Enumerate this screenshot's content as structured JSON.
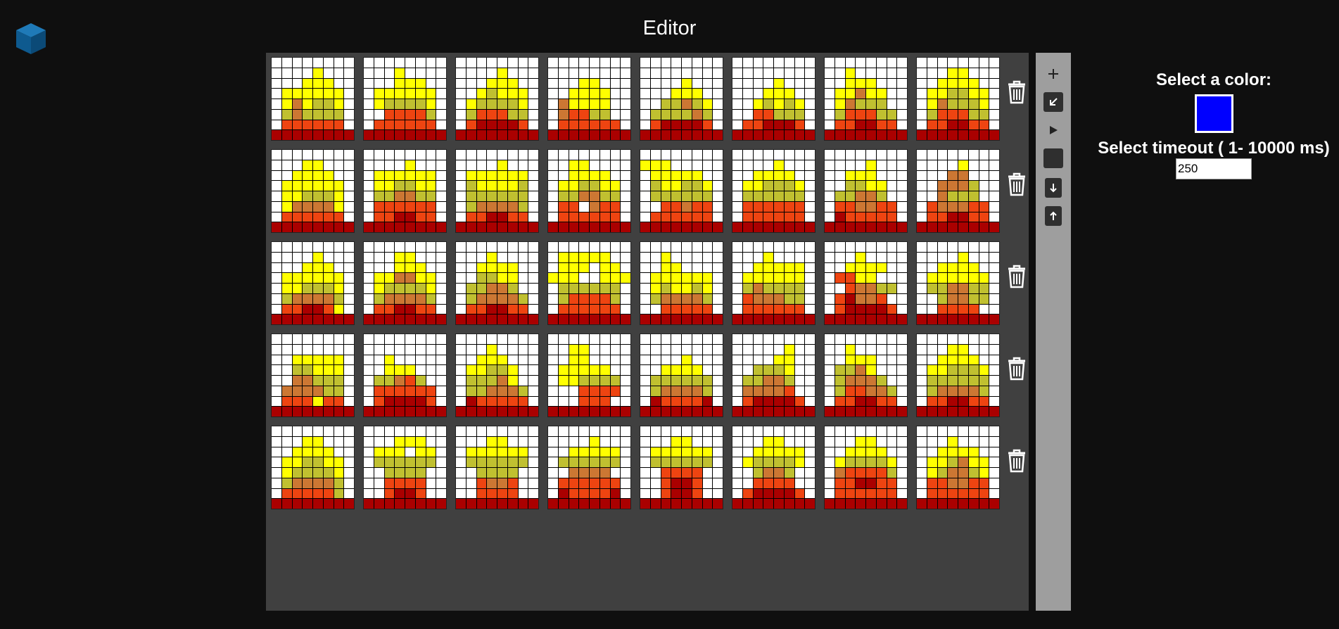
{
  "header": {
    "title": "Editor"
  },
  "app": {
    "logo_icon": "cube-icon"
  },
  "sidebar": {
    "color_label": "Select a color:",
    "selected_color": "#0000ff",
    "timeout_label": "Select timeout ( 1- 10000 ms)",
    "timeout_value": "250"
  },
  "toolbar": {
    "buttons": [
      {
        "name": "add-frame-button",
        "icon": "plus-icon"
      },
      {
        "name": "collapse-button",
        "icon": "arrow-down-left-icon"
      },
      {
        "name": "play-button",
        "icon": "play-icon"
      },
      {
        "name": "stop-button",
        "icon": "stop-icon"
      },
      {
        "name": "download-button",
        "icon": "arrow-down-icon"
      },
      {
        "name": "upload-button",
        "icon": "arrow-up-icon"
      }
    ]
  },
  "palette": {
    "W": "#ffffff",
    "Y": "#ffff00",
    "O": "#c0c030",
    "B": "#cc7733",
    "R": "#ee4411",
    "D": "#aa0000"
  },
  "frames": [
    [
      "WWWWWWWW",
      "WWWWYWWW",
      "WWWYYYWW",
      "WYYYYYYW",
      "WYBYOOYW",
      "WOBOOOOW",
      "WRRRRRRW",
      "DDDDDDDD"
    ],
    [
      "WWWWWWWW",
      "WWWYWWWW",
      "WWWYYYWW",
      "WYYYYYYW",
      "WYOOOOYW",
      "WWRRRROW",
      "WRRRRRRW",
      "DDDDDDDD"
    ],
    [
      "WWWWWWWW",
      "WWWWYWWW",
      "WWWYYYWW",
      "WWYOYYYW",
      "WYOOOOYW",
      "WORRROOW",
      "WRDDDDRW",
      "DDDDDDDD"
    ],
    [
      "WWWWWWWW",
      "WWWWWWWW",
      "WWWYYWWW",
      "WWYYYYWW",
      "WBYYYYWW",
      "WBRROOWW",
      "WRRRRRRW",
      "DDDDDDDD"
    ],
    [
      "WWWWWWWW",
      "WWWWWWWW",
      "WWWWYWWW",
      "WWWYYYWW",
      "WWOOBOYW",
      "WOOOOBOW",
      "WRDDDDRW",
      "DDDDDDDD"
    ],
    [
      "WWWWWWWW",
      "WWWWWWWW",
      "WWWWYWWW",
      "WWWYYYWW",
      "WWYOYOYW",
      "WWRROOOW",
      "WRRDDDRW",
      "DDDDDDDD"
    ],
    [
      "WWWWWWWW",
      "WWYWWWWW",
      "WWYYYWWW",
      "WYYBYYWW",
      "WYBOOOWW",
      "WORRROOW",
      "WRRDDRRW",
      "DDDDDDDD"
    ],
    [
      "WWWWWWWW",
      "WWWYYWWW",
      "WWYYYYWW",
      "WYYOOYYW",
      "WYBOOOYW",
      "WORRROOW",
      "WRRDDRRW",
      "DDDDDDDD"
    ],
    [
      "WWWWWWWW",
      "WWWYYWWW",
      "WWYYYYWW",
      "WYYYYYYW",
      "WYYOOOYW",
      "WYBBBBYW",
      "WRRRRRRW",
      "DDDDDDDD"
    ],
    [
      "WWWWWWWW",
      "WWWWYWWW",
      "WYYYYYYW",
      "WYYOOYYW",
      "WOOBBOOW",
      "WRRRRRRW",
      "WRRDDRRW",
      "DDDDDDDD"
    ],
    [
      "WWWWWWWW",
      "WWWWYWWW",
      "WYYYYYYW",
      "WOYYYYOW",
      "WOOOOOOW",
      "WOBBBBOW",
      "WRRDDRRW",
      "DDDDDDDD"
    ],
    [
      "WWWWWWWW",
      "WWYYWWWW",
      "WWYYYYWW",
      "WYYOOYYW",
      "WOOBBOOW",
      "WRRWBRRW",
      "WRRRRRRW",
      "DDDDDDDD"
    ],
    [
      "WWWWWWWW",
      "YYYWWWWW",
      "WYYYYYWW",
      "WOYYOOYW",
      "WOOOOOOW",
      "WWRRBRRW",
      "WRRRRRRW",
      "DDDDDDDD"
    ],
    [
      "WWWWWWWW",
      "WWWWYWWW",
      "WWYYYYWW",
      "WYYOOOYW",
      "WOOOOOOW",
      "WRRRRRRW",
      "WRRRRRRW",
      "DDDDDDDD"
    ],
    [
      "WWWWWWWW",
      "WWWWYWWW",
      "WWYYYWWW",
      "WWOOYYWW",
      "WOOBBOWW",
      "WRRBBRRW",
      "WDRRRRRW",
      "DDDDDDDD"
    ],
    [
      "WWWWWWWW",
      "WWWWYWWW",
      "WWWBBWWW",
      "WWBBBOWW",
      "WWBOOOWW",
      "WRBBBRRW",
      "WRRDDRRW",
      "DDDDDDDD"
    ],
    [
      "WWWWWWWW",
      "WWWWYWWW",
      "WWWYYYWW",
      "WYYYYYYW",
      "WYYOOOYW",
      "WOBBBBOW",
      "WRRDDRYW",
      "DDDDDDDD"
    ],
    [
      "WWWWWWWW",
      "WWWYYWWW",
      "WWWYYYWW",
      "WYYBBYYW",
      "WYOOOOYW",
      "WOBBBBOW",
      "WRRDDRRW",
      "DDDDDDDD"
    ],
    [
      "WWWWWWWW",
      "WWWYWWWW",
      "WWYYYYWW",
      "WWOOYYWW",
      "WOOBBOWW",
      "WOBBBBOW",
      "WRRDDRRW",
      "DDDDDDDD"
    ],
    [
      "WWWWWWWW",
      "WYYYYYWW",
      "WYYYWYYW",
      "YYYWWYYY",
      "WOOOOOOW",
      "WORRRROW",
      "WRRRRRRW",
      "DDDDDDDD"
    ],
    [
      "WWWWWWWW",
      "WWYWWWWW",
      "WWYYWWWW",
      "WYYYYYYW",
      "WYOYYOYW",
      "WOBBBBOW",
      "WWRRRRRW",
      "DDDDDDDD"
    ],
    [
      "WWWWWWWW",
      "WWWYWWWW",
      "WWYYYYYW",
      "WYYYYYYW",
      "WOBOOOOW",
      "WRBBBOOW",
      "WRRRRRRW",
      "DDDDDDDD"
    ],
    [
      "WWWWWWWW",
      "WWWYWWWW",
      "WWYYYYWW",
      "WRRYYWWW",
      "WWRBBOOW",
      "WRDBBRWW",
      "WRDDDDRW",
      "DDDDDDDD"
    ],
    [
      "WWWWWWWW",
      "WWWWYWWW",
      "WWYYYYWW",
      "WYYYYYYW",
      "WOOBBOOW",
      "WWOBBOOW",
      "WWRRRRWW",
      "DDDDDDDD"
    ],
    [
      "WWWWWWWW",
      "WWWWWWWW",
      "WWYYYYYW",
      "WWOOYYYW",
      "WWBBOOOW",
      "WBBBBOOW",
      "WRRRYRRW",
      "DDDDDDDD"
    ],
    [
      "WWWWWWWW",
      "WWWWWWWW",
      "WWYWWWWW",
      "WWYYYWWW",
      "WOOBROWW",
      "WRRRRRRW",
      "WRDDDDRW",
      "DDDDDDDD"
    ],
    [
      "WWWWWWWW",
      "WWWYWWWW",
      "WWYYYWWW",
      "WYYOOYWW",
      "WOOOBYWW",
      "WOOBBBOW",
      "WDRRRRRW",
      "DDDDDDDD"
    ],
    [
      "WWWWWWWW",
      "WWYYWWWW",
      "WWYYWWWW",
      "WYYYYYWW",
      "WYYOOOOW",
      "WWWRRRRW",
      "WWWRRRWW",
      "DDDDDDDD"
    ],
    [
      "WWWWWWWW",
      "WWWWWWWW",
      "WWWWYWWW",
      "WWYYYYWW",
      "WOOOOOOW",
      "WOBBBBOW",
      "WDRRRRDW",
      "DDDDDDDD"
    ],
    [
      "WWWWWWWW",
      "WWWWWYWW",
      "WWWWYYWW",
      "WWOOOYWW",
      "WOOBBOWW",
      "WBBBBRWW",
      "WRDDDDRW",
      "DDDDDDDD"
    ],
    [
      "WWWWWWWW",
      "WWYWWWWW",
      "WWYYYWWW",
      "WOOBYWWW",
      "WOBBBOWW",
      "WORRBBOW",
      "WRRDDRRW",
      "DDDDDDDD"
    ],
    [
      "WWWWWWWW",
      "WWWYYWWW",
      "WWYYYYWW",
      "WYYOOOYW",
      "WOOOOOOW",
      "WOBBBBOW",
      "WRRDDRRW",
      "DDDDDDDD"
    ],
    [
      "WWWWWWWW",
      "WWWYYWWW",
      "WWYYYYWW",
      "WYYOOYYW",
      "WYOOOOYW",
      "WOBBBBOW",
      "WRRRRROW",
      "DDDDDDDD"
    ],
    [
      "WWWWWWWW",
      "WWWYYYWW",
      "WYYYWYYW",
      "WOOOOOOW",
      "WWOOOOWW",
      "WWRRRRWW",
      "WWRDDRWW",
      "DDDDDDDD"
    ],
    [
      "WWWWWWWW",
      "WWWYYWWW",
      "WYYYYYYW",
      "WOOOOOOW",
      "WWOOOOWW",
      "WWRBBRWW",
      "WWRRRRWW",
      "DDDDDDDD"
    ],
    [
      "WWWWWWWW",
      "WWWWYWWW",
      "WWYYYYYW",
      "WOOOOOOW",
      "WWBBBBWW",
      "WRRRRRRW",
      "WDRRRRDW",
      "DDDDDDDD"
    ],
    [
      "WWWWWWWW",
      "WWWYYWWW",
      "WYYYYYYW",
      "WOOOOOOW",
      "WWRRRRWW",
      "WWRDDRWW",
      "WWRDDRWW",
      "DDDDDDDD"
    ],
    [
      "WWWWWWWW",
      "WWWYYWWW",
      "WWYYYYYW",
      "WYOOOOYW",
      "WWOBBOWW",
      "WWRRRRWW",
      "WRDDDDRW",
      "DDDDDDDD"
    ],
    [
      "WWWWWWWW",
      "WWWYYWWW",
      "WWYYYYWW",
      "WYOOOOYW",
      "WBRRRROW",
      "WRRDDRRW",
      "WRRRRRRW",
      "DDDDDDDD"
    ],
    [
      "WWWWWWWW",
      "WWWYWWWW",
      "WWYYYYWW",
      "WYYOBYYW",
      "WYOBBOYW",
      "WRRBBRRW",
      "WRRRRRRW",
      "DDDDDDDD"
    ]
  ]
}
